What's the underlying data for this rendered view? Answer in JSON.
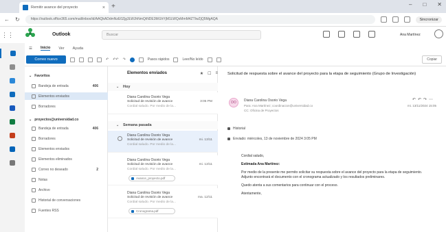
{
  "browser": {
    "tab_title": "Remitir avance del proyecto",
    "tab_close": "×",
    "new_tab": "+",
    "url": "https://outlook.office365.com/mail/inbox/id/AAQkADdmNzE0Zjg3LWJhNmQtNDE3Mi1hYjM1LWQxMmM4ZTIwZjQ5MgAQA",
    "profile_label": "Sincronizar",
    "window_controls": [
      "–",
      "□",
      "✕"
    ]
  },
  "app": {
    "name": "Outlook",
    "search_placeholder": "Buscar",
    "user_name": "Ana Martínez"
  },
  "ribbon_tabs": [
    "Inicio",
    "Ver",
    "Ayuda"
  ],
  "ribbon": {
    "new_mail": "Correo nuevo",
    "quick_steps": "Pasos rápidos",
    "reply": "Leer/No leído",
    "view": "Copiar"
  },
  "folders": [
    {
      "label": "Favoritos",
      "type": "section"
    },
    {
      "label": "Bandeja de entrada",
      "count": "406"
    },
    {
      "label": "Elementos enviados",
      "selected": true
    },
    {
      "label": "Borradores"
    },
    {
      "label": "proyectos@universidad.co",
      "type": "section"
    },
    {
      "label": "Bandeja de entrada",
      "count": "406"
    },
    {
      "label": "Borradores"
    },
    {
      "label": "Elementos enviados"
    },
    {
      "label": "Elementos eliminados"
    },
    {
      "label": "Correo no deseado",
      "count": "2"
    },
    {
      "label": "Notas"
    },
    {
      "label": "Archivo"
    },
    {
      "label": "Historial de conversaciones"
    },
    {
      "label": "Fuentes RSS"
    }
  ],
  "message_list": {
    "title": "Elementos enviados",
    "groups": [
      {
        "label": "Hoy",
        "items": [
          {
            "from": "Diana Carolina Osorio Vega",
            "subject": "Solicitud de revisión de avance",
            "preview": "Cordial saludo. Por medio de la...",
            "date": "3:05 PM"
          }
        ]
      },
      {
        "label": "Semana pasada",
        "items": [
          {
            "from": "Diana Carolina Osorio Vega",
            "subject": "Solicitud de revisión de avance",
            "preview": "Cordial saludo. Por medio de la...",
            "date": "mi. 13/11",
            "selected": true
          },
          {
            "from": "Diana Carolina Osorio Vega",
            "subject": "Solicitud de revisión de avance",
            "preview": "Cordial saludo. Por medio de la...",
            "date": "mi. 13/11",
            "attachment": "Avance_proyecto.pdf"
          },
          {
            "from": "Diana Carolina Osorio Vega",
            "subject": "Solicitud de revisión de avance",
            "preview": "Cordial saludo. Por medio de la...",
            "date": "ma. 12/11",
            "attachment": "Cronograma.pdf"
          }
        ]
      }
    ]
  },
  "reading_pane": {
    "subject": "Solicitud de respuesta sobre el avance del proyecto para la etapa de seguimiento (Grupo de Investigación)",
    "sender": "Diana Carolina Osorio Vega",
    "recipients": "Para: Ana Martínez; coordinacion@universidad.co",
    "cc": "CC: Oficina de Proyectos",
    "date": "mi. 13/11/2024 15:05",
    "avatar_initials": "DO",
    "bar1": "Historial",
    "bar2": "Enviado: miércoles, 13 de noviembre de 2024 3:05 PM",
    "body": {
      "greeting": "Cordial saludo,",
      "salutation": "Estimada Ana Martínez:",
      "p1": "Por medio de la presente me permito solicitar su respuesta sobre el avance del proyecto para la etapa de seguimiento. Adjunto encontrará el documento con el cronograma actualizado y los resultados preliminares.",
      "p2": "Quedo atenta a sus comentarios para continuar con el proceso.",
      "closing": "Atentamente,"
    }
  }
}
